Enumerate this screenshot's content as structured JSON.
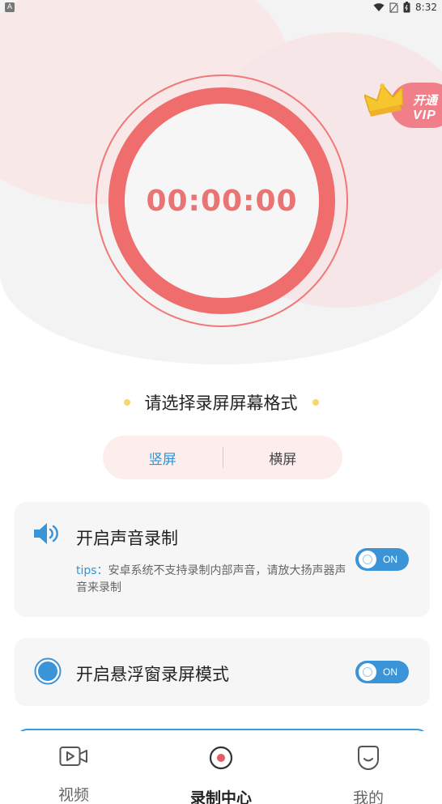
{
  "status_bar": {
    "left_badge": "A",
    "time": "8:32"
  },
  "timer": {
    "value": "00:00:00"
  },
  "vip_badge": {
    "line1": "开通",
    "line2": "VIP"
  },
  "format_select": {
    "title": "请选择录屏屏幕格式",
    "options": [
      {
        "label": "竖屏",
        "active": true
      },
      {
        "label": "横屏",
        "active": false
      }
    ]
  },
  "audio_card": {
    "title": "开启声音录制",
    "tips_label": "tips：",
    "tips_text": "安卓系统不支持录制内部声音，请放大扬声器声音来录制",
    "toggle_label": "ON",
    "toggle_on": true
  },
  "float_card": {
    "title": "开启悬浮窗录屏模式",
    "toggle_label": "ON",
    "toggle_on": true
  },
  "tabs": [
    {
      "label": "视频",
      "icon": "video-icon",
      "active": false
    },
    {
      "label": "录制中心",
      "icon": "record-icon",
      "active": true
    },
    {
      "label": "我的",
      "icon": "smile-icon",
      "active": false
    }
  ],
  "colors": {
    "accent_red": "#ef6d6d",
    "accent_blue": "#3b93d8",
    "link_blue": "#2a97d6",
    "vip_pink": "#f17f8a"
  }
}
